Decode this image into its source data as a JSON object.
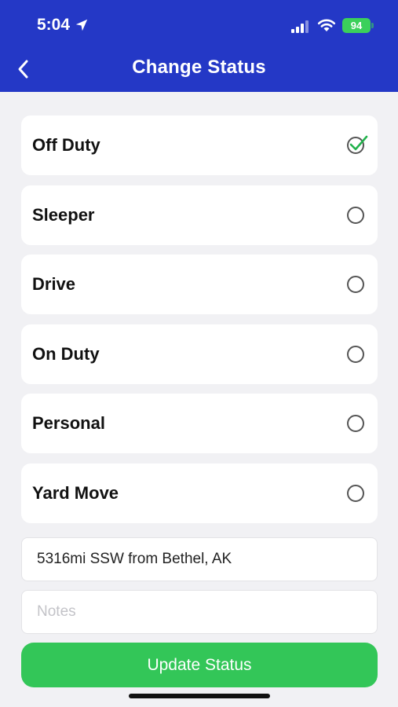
{
  "status_bar": {
    "time": "5:04",
    "battery": "94"
  },
  "header": {
    "title": "Change Status",
    "background_color": "#2438c6"
  },
  "statuses": [
    {
      "label": "Off Duty",
      "selected": true
    },
    {
      "label": "Sleeper",
      "selected": false
    },
    {
      "label": "Drive",
      "selected": false
    },
    {
      "label": "On Duty",
      "selected": false
    },
    {
      "label": "Personal",
      "selected": false
    },
    {
      "label": "Yard Move",
      "selected": false
    }
  ],
  "location": {
    "value": "5316mi SSW from Bethel, AK"
  },
  "notes": {
    "placeholder": "Notes",
    "value": ""
  },
  "update_button": {
    "label": "Update Status",
    "color": "#33c658"
  },
  "icons": [
    "location-arrow-icon",
    "signal-icon",
    "wifi-icon",
    "battery-icon",
    "back-chevron-icon",
    "checkmark-icon",
    "radio-icon"
  ]
}
